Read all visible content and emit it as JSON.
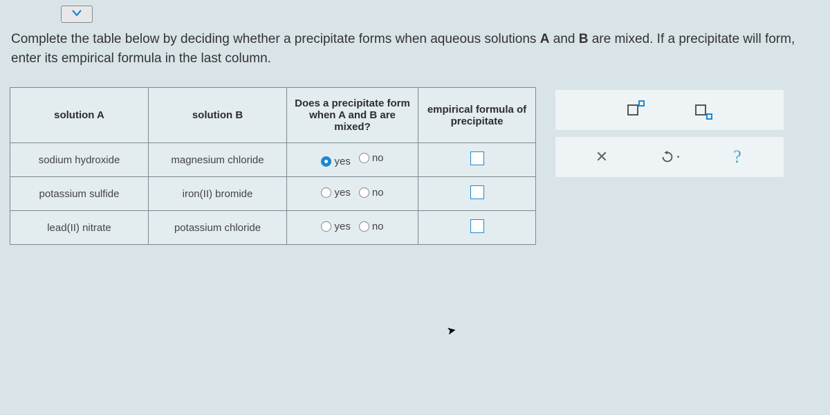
{
  "prompt_html": "Complete the table below by deciding whether a precipitate forms when aqueous solutions <b>A</b> and <b>B</b> are mixed. If a precipitate will form, enter its empirical formula in the last column.",
  "headers": {
    "colA": "solution A",
    "colB": "solution B",
    "colC": "Does a precipitate form when A and B are mixed?",
    "colD": "empirical formula of precipitate"
  },
  "labels": {
    "yes": "yes",
    "no": "no"
  },
  "rows": [
    {
      "a": "sodium hydroxide",
      "b": "magnesium chloride",
      "sel": "yes"
    },
    {
      "a": "potassium sulfide",
      "b": "iron(II) bromide",
      "sel": ""
    },
    {
      "a": "lead(II) nitrate",
      "b": "potassium chloride",
      "sel": ""
    }
  ]
}
